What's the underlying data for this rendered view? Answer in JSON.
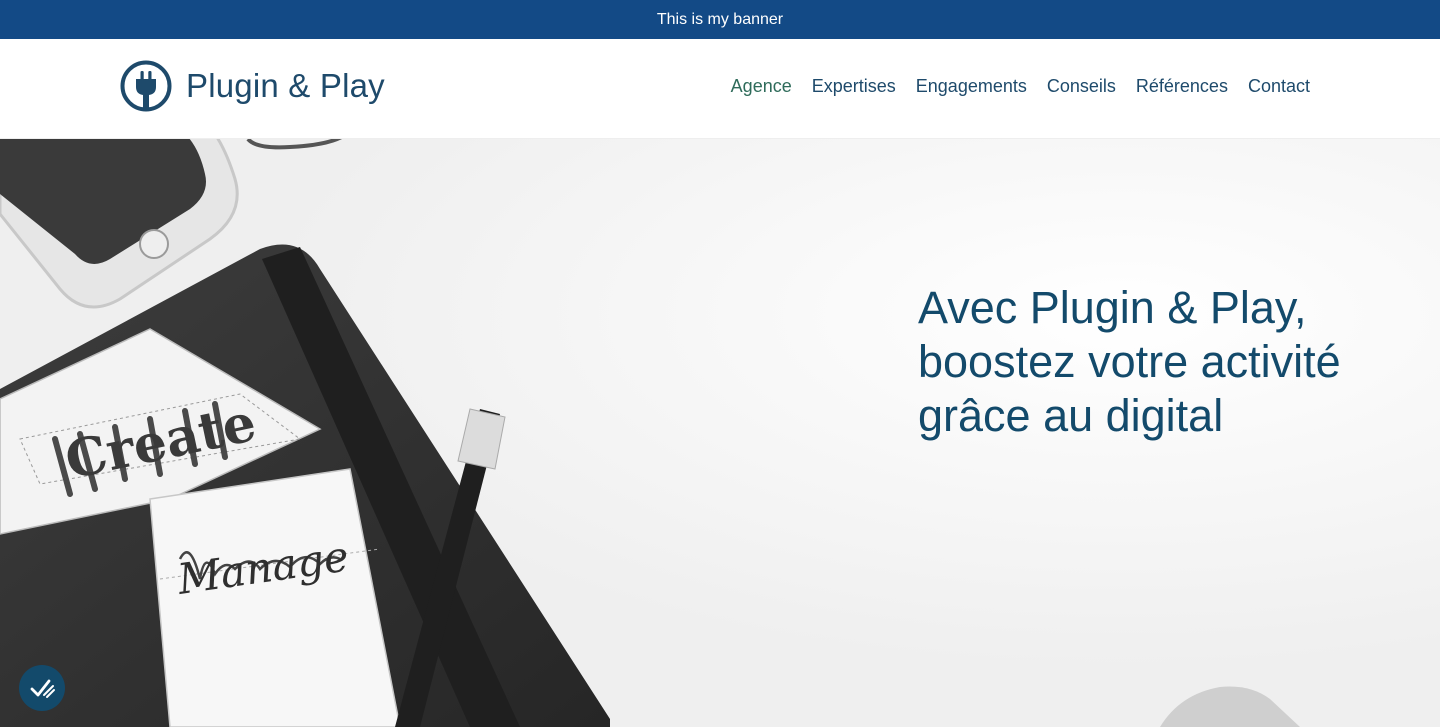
{
  "banner": {
    "text": "This is my banner"
  },
  "header": {
    "logo_text": "Plugin & Play",
    "logo_icon": "plug-circle-icon"
  },
  "nav": {
    "items": [
      {
        "label": "Agence",
        "active": true
      },
      {
        "label": "Expertises",
        "active": false
      },
      {
        "label": "Engagements",
        "active": false
      },
      {
        "label": "Conseils",
        "active": false
      },
      {
        "label": "Références",
        "active": false
      },
      {
        "label": "Contact",
        "active": false
      }
    ]
  },
  "hero": {
    "headline_lines": [
      "Avec Plugin & Play,",
      "boostez votre activité",
      "grâce au digital"
    ],
    "image_words": [
      "Create",
      "Manage"
    ]
  },
  "accessibility": {
    "icon": "accessibility-check-icon"
  },
  "colors": {
    "banner_bg": "#134a86",
    "brand_text": "#1e4a6b",
    "active_nav": "#2e6b5a",
    "headline": "#134a6b"
  }
}
